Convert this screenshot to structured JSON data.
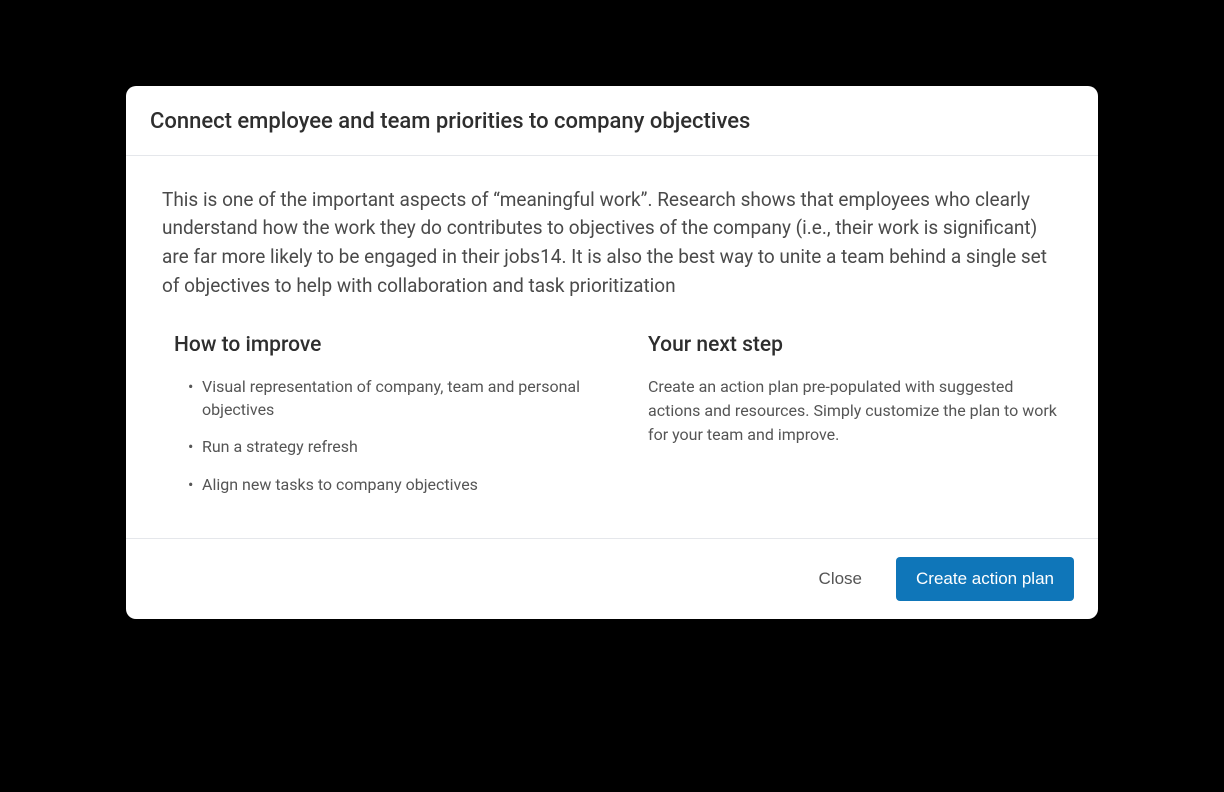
{
  "modal": {
    "title": "Connect employee and team priorities to company objectives",
    "intro": "This is one of the important aspects of “meaningful work”. Research shows that employees who clearly understand how the work they do contributes to objectives of the company (i.e., their work is significant) are far more likely to be engaged in their jobs14. It is also the best way to unite a team behind a single set of objectives to help with collaboration and task prioritization",
    "improve": {
      "heading": "How to improve",
      "items": [
        "Visual representation of company, team and personal objectives",
        "Run a strategy refresh",
        "Align new tasks to company objectives"
      ]
    },
    "next_step": {
      "heading": "Your next step",
      "text": "Create an action plan pre-populated with suggested actions and resources. Simply customize the plan to work for your team and improve."
    },
    "footer": {
      "close_label": "Close",
      "create_label": "Create action plan"
    }
  }
}
